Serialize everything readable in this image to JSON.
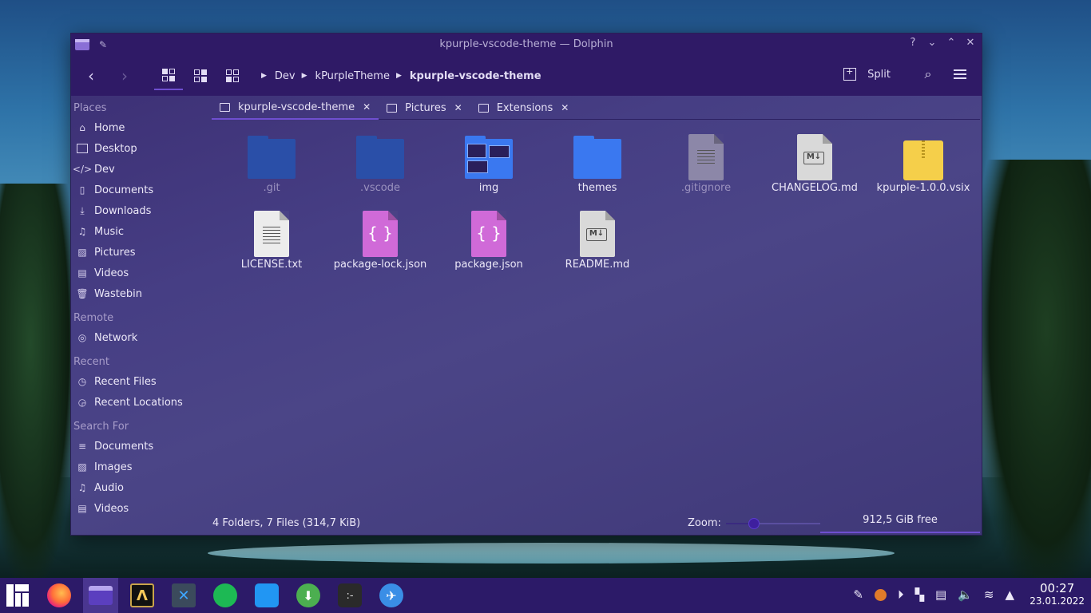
{
  "window": {
    "title": "kpurple-vscode-theme — Dolphin"
  },
  "toolbar": {
    "breadcrumbs": [
      "Dev",
      "kPurpleTheme",
      "kpurple-vscode-theme"
    ],
    "split_label": "Split"
  },
  "sidebar": {
    "sections": [
      {
        "title": "Places",
        "items": [
          {
            "label": "Home",
            "icon": "home-icon"
          },
          {
            "label": "Desktop",
            "icon": "desktop-icon"
          },
          {
            "label": "Dev",
            "icon": "code-icon"
          },
          {
            "label": "Documents",
            "icon": "documents-icon"
          },
          {
            "label": "Downloads",
            "icon": "download-icon"
          },
          {
            "label": "Music",
            "icon": "music-icon"
          },
          {
            "label": "Pictures",
            "icon": "pictures-icon"
          },
          {
            "label": "Videos",
            "icon": "video-icon"
          },
          {
            "label": "Wastebin",
            "icon": "trash-icon"
          }
        ]
      },
      {
        "title": "Remote",
        "items": [
          {
            "label": "Network",
            "icon": "network-icon"
          }
        ]
      },
      {
        "title": "Recent",
        "items": [
          {
            "label": "Recent Files",
            "icon": "recent-files-icon"
          },
          {
            "label": "Recent Locations",
            "icon": "recent-locations-icon"
          }
        ]
      },
      {
        "title": "Search For",
        "items": [
          {
            "label": "Documents",
            "icon": "documents-icon"
          },
          {
            "label": "Images",
            "icon": "images-icon"
          },
          {
            "label": "Audio",
            "icon": "music-icon"
          },
          {
            "label": "Videos",
            "icon": "video-icon"
          }
        ]
      }
    ]
  },
  "tabs": [
    {
      "label": "kpurple-vscode-theme",
      "active": true
    },
    {
      "label": "Pictures",
      "active": false
    },
    {
      "label": "Extensions",
      "active": false
    }
  ],
  "files": [
    {
      "name": ".git",
      "kind": "folder",
      "hidden": true
    },
    {
      "name": ".vscode",
      "kind": "folder",
      "hidden": true
    },
    {
      "name": "img",
      "kind": "folder-images",
      "hidden": false
    },
    {
      "name": "themes",
      "kind": "folder",
      "hidden": false
    },
    {
      "name": ".gitignore",
      "kind": "text",
      "hidden": true
    },
    {
      "name": "CHANGELOG.md",
      "kind": "markdown",
      "hidden": false
    },
    {
      "name": "kpurple-1.0.0.vsix",
      "kind": "archive",
      "hidden": false
    },
    {
      "name": "LICENSE.txt",
      "kind": "text",
      "hidden": false
    },
    {
      "name": "package-lock.json",
      "kind": "json",
      "hidden": false
    },
    {
      "name": "package.json",
      "kind": "json",
      "hidden": false
    },
    {
      "name": "README.md",
      "kind": "markdown",
      "hidden": false
    }
  ],
  "status": {
    "summary": "4 Folders, 7 Files (314,7 KiB)",
    "zoom_label": "Zoom:",
    "zoom_level": 0.3,
    "free_space": "912,5 GiB free"
  },
  "taskbar": {
    "apps": [
      "application-menu",
      "firefox",
      "dolphin",
      "inkscape",
      "vscode",
      "spotify",
      "kate",
      "downloader",
      "terminal",
      "browser"
    ],
    "clock_time": "00:27",
    "clock_date": "23.01.2022"
  },
  "colors": {
    "accent": "#6f4fd0",
    "titlebar": "#2f1a66",
    "folder": "#3166d8",
    "taskbar": "#2c1a68"
  }
}
